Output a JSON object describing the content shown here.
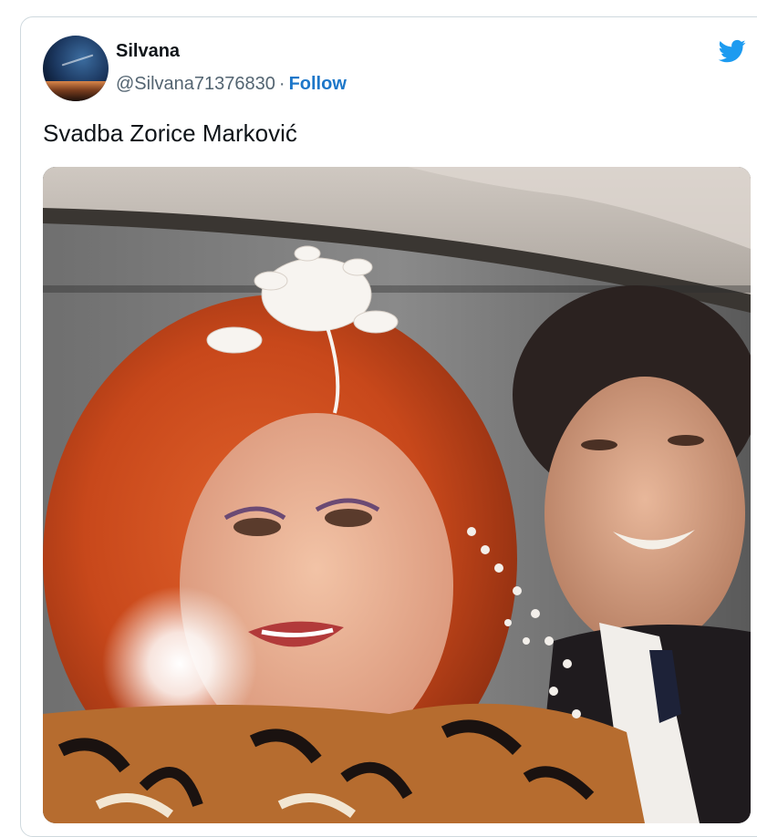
{
  "tweet": {
    "display_name": "Silvana",
    "handle": "@Silvana71376830",
    "separator": "·",
    "follow_label": "Follow",
    "text": "Svadba Zorice Marković",
    "brand_icon": "twitter-bird-icon",
    "colors": {
      "follow": "#1d77c9",
      "brand": "#1d9bf0",
      "handle": "#536471",
      "text": "#0f1419",
      "border": "#cfd9de"
    }
  }
}
